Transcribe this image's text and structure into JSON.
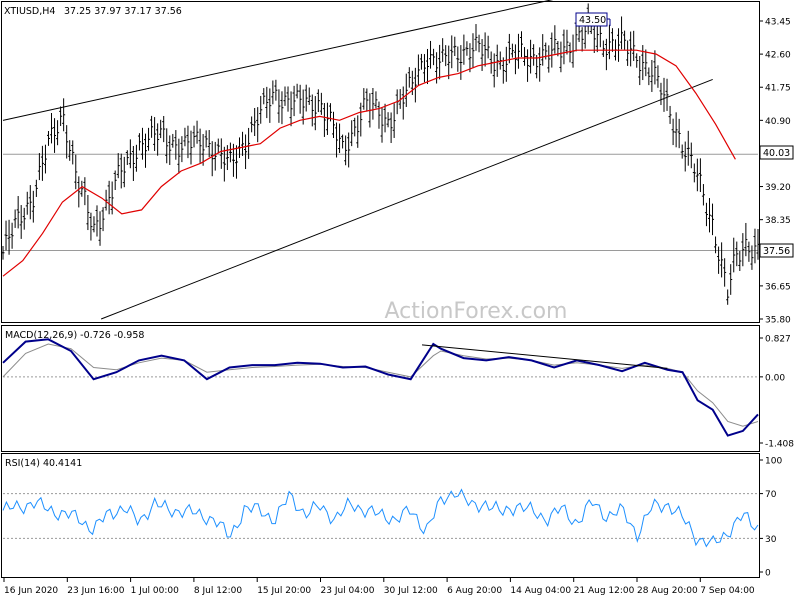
{
  "header": {
    "symbol": "XTIUSD,H4",
    "ohlc": "37.25 37.97 37.17 37.56"
  },
  "watermark": "ActionForex.com",
  "colors": {
    "price": "#000000",
    "ma": "#e00000",
    "macd_main": "#00008b",
    "macd_signal": "#8c8c8c",
    "rsi": "#1e90ff",
    "ref_line": "#9a9a9a",
    "label_fill": "#ffffff"
  },
  "price_panel": {
    "ticks": [
      "43.45",
      "42.60",
      "41.75",
      "40.90",
      "40.03",
      "39.20",
      "38.35",
      "37.56",
      "36.65",
      "35.80"
    ],
    "high_label": "43.50",
    "level_label": "40.03",
    "current_label": "37.56"
  },
  "macd_panel": {
    "title": "MACD(12,26,9) -0.726 -0.958",
    "ticks": [
      "0.827",
      "0.00",
      "-1.408"
    ]
  },
  "rsi_panel": {
    "title": "RSI(14) 40.4141",
    "ticks": [
      "100",
      "70",
      "30",
      "0"
    ]
  },
  "x_labels": [
    "16 Jun 2020",
    "23 Jun 16:00",
    "1 Jul 00:00",
    "8 Jul 12:00",
    "15 Jul 20:00",
    "23 Jul 04:00",
    "30 Jul 12:00",
    "6 Aug 20:00",
    "14 Aug 04:00",
    "21 Aug 12:00",
    "28 Aug 20:00",
    "7 Sep 04:00"
  ],
  "chart_data": {
    "type": "line",
    "symbol": "XTIUSD",
    "timeframe": "H4",
    "x_range": [
      "16 Jun 2020",
      "8 Sep 2020"
    ],
    "price": {
      "ylim": [
        35.8,
        43.45
      ],
      "last": 37.56,
      "high": 43.5,
      "low": 36.0,
      "x": [
        0.0,
        0.02,
        0.04,
        0.06,
        0.08,
        0.1,
        0.12,
        0.15,
        0.18,
        0.21,
        0.24,
        0.27,
        0.3,
        0.33,
        0.36,
        0.39,
        0.42,
        0.45,
        0.48,
        0.51,
        0.54,
        0.56,
        0.58,
        0.6,
        0.63,
        0.66,
        0.69,
        0.72,
        0.75,
        0.78,
        0.8,
        0.82,
        0.84,
        0.86,
        0.88,
        0.9,
        0.92,
        0.94,
        0.96,
        0.97,
        0.985,
        1.0
      ],
      "close": [
        37.5,
        38.3,
        39.0,
        40.2,
        41.1,
        39.2,
        38.1,
        39.3,
        40.3,
        40.5,
        40.2,
        40.4,
        39.7,
        40.7,
        41.6,
        41.3,
        41.4,
        40.1,
        41.3,
        40.9,
        41.7,
        42.6,
        42.3,
        42.7,
        42.7,
        42.4,
        42.6,
        42.5,
        42.9,
        43.2,
        42.9,
        42.8,
        42.6,
        42.1,
        41.3,
        40.3,
        39.4,
        38.3,
        36.4,
        37.3,
        37.8,
        37.56
      ]
    },
    "moving_average": {
      "values": [
        36.9,
        37.3,
        38.0,
        38.8,
        39.2,
        38.9,
        38.5,
        38.6,
        39.2,
        39.6,
        39.8,
        40.1,
        40.2,
        40.3,
        40.7,
        40.9,
        41.0,
        40.9,
        41.1,
        41.2,
        41.4,
        41.8,
        42.0,
        42.1,
        42.3,
        42.4,
        42.5,
        42.5,
        42.6,
        42.7,
        42.7,
        42.7,
        42.7,
        42.6,
        42.3,
        41.6,
        40.8,
        39.9
      ]
    },
    "trendlines": [
      {
        "name": "upper channel",
        "from": [
          0.0,
          40.9
        ],
        "to": [
          0.74,
          44.05
        ]
      },
      {
        "name": "lower channel",
        "from": [
          0.13,
          35.8
        ],
        "to": [
          0.94,
          41.95
        ]
      }
    ],
    "horizontal_levels": [
      40.03,
      37.56
    ],
    "macd": {
      "ylim": [
        -1.408,
        0.827
      ],
      "x": [
        0.0,
        0.03,
        0.06,
        0.09,
        0.12,
        0.15,
        0.18,
        0.21,
        0.24,
        0.27,
        0.3,
        0.33,
        0.36,
        0.39,
        0.42,
        0.45,
        0.48,
        0.51,
        0.54,
        0.57,
        0.58,
        0.61,
        0.64,
        0.67,
        0.7,
        0.73,
        0.76,
        0.79,
        0.82,
        0.85,
        0.88,
        0.9,
        0.92,
        0.94,
        0.96,
        0.98,
        1.0
      ],
      "main": [
        0.3,
        0.75,
        0.8,
        0.55,
        -0.05,
        0.1,
        0.35,
        0.45,
        0.35,
        -0.05,
        0.2,
        0.25,
        0.25,
        0.3,
        0.28,
        0.2,
        0.22,
        0.05,
        -0.05,
        0.7,
        0.6,
        0.4,
        0.35,
        0.42,
        0.35,
        0.2,
        0.35,
        0.25,
        0.12,
        0.3,
        0.15,
        0.1,
        -0.5,
        -0.7,
        -1.25,
        -1.15,
        -0.8
      ],
      "signal": [
        0.0,
        0.5,
        0.7,
        0.6,
        0.2,
        0.15,
        0.3,
        0.4,
        0.35,
        0.1,
        0.15,
        0.2,
        0.22,
        0.25,
        0.27,
        0.22,
        0.2,
        0.1,
        0.0,
        0.45,
        0.55,
        0.45,
        0.38,
        0.4,
        0.35,
        0.25,
        0.3,
        0.25,
        0.18,
        0.25,
        0.18,
        0.1,
        -0.3,
        -0.55,
        -0.95,
        -1.05,
        -0.95
      ],
      "divergence_line": {
        "from": [
          0.555,
          0.68
        ],
        "to": [
          0.88,
          0.18
        ]
      }
    },
    "rsi": {
      "ylim": [
        0,
        100
      ],
      "levels": [
        70,
        30
      ],
      "x": [
        0.0,
        0.02,
        0.04,
        0.06,
        0.08,
        0.1,
        0.12,
        0.14,
        0.16,
        0.18,
        0.2,
        0.22,
        0.24,
        0.26,
        0.28,
        0.3,
        0.32,
        0.34,
        0.36,
        0.38,
        0.4,
        0.42,
        0.44,
        0.46,
        0.48,
        0.5,
        0.52,
        0.54,
        0.56,
        0.58,
        0.6,
        0.62,
        0.64,
        0.66,
        0.68,
        0.7,
        0.72,
        0.74,
        0.76,
        0.78,
        0.8,
        0.82,
        0.84,
        0.86,
        0.88,
        0.9,
        0.92,
        0.94,
        0.96,
        0.98,
        1.0
      ],
      "values": [
        55,
        58,
        62,
        56,
        52,
        48,
        38,
        52,
        58,
        44,
        62,
        54,
        56,
        50,
        48,
        30,
        57,
        55,
        47,
        68,
        52,
        58,
        48,
        60,
        56,
        50,
        48,
        54,
        38,
        62,
        74,
        58,
        62,
        52,
        60,
        54,
        48,
        56,
        44,
        62,
        50,
        55,
        34,
        58,
        61,
        48,
        30,
        24,
        36,
        50,
        40
      ]
    }
  }
}
